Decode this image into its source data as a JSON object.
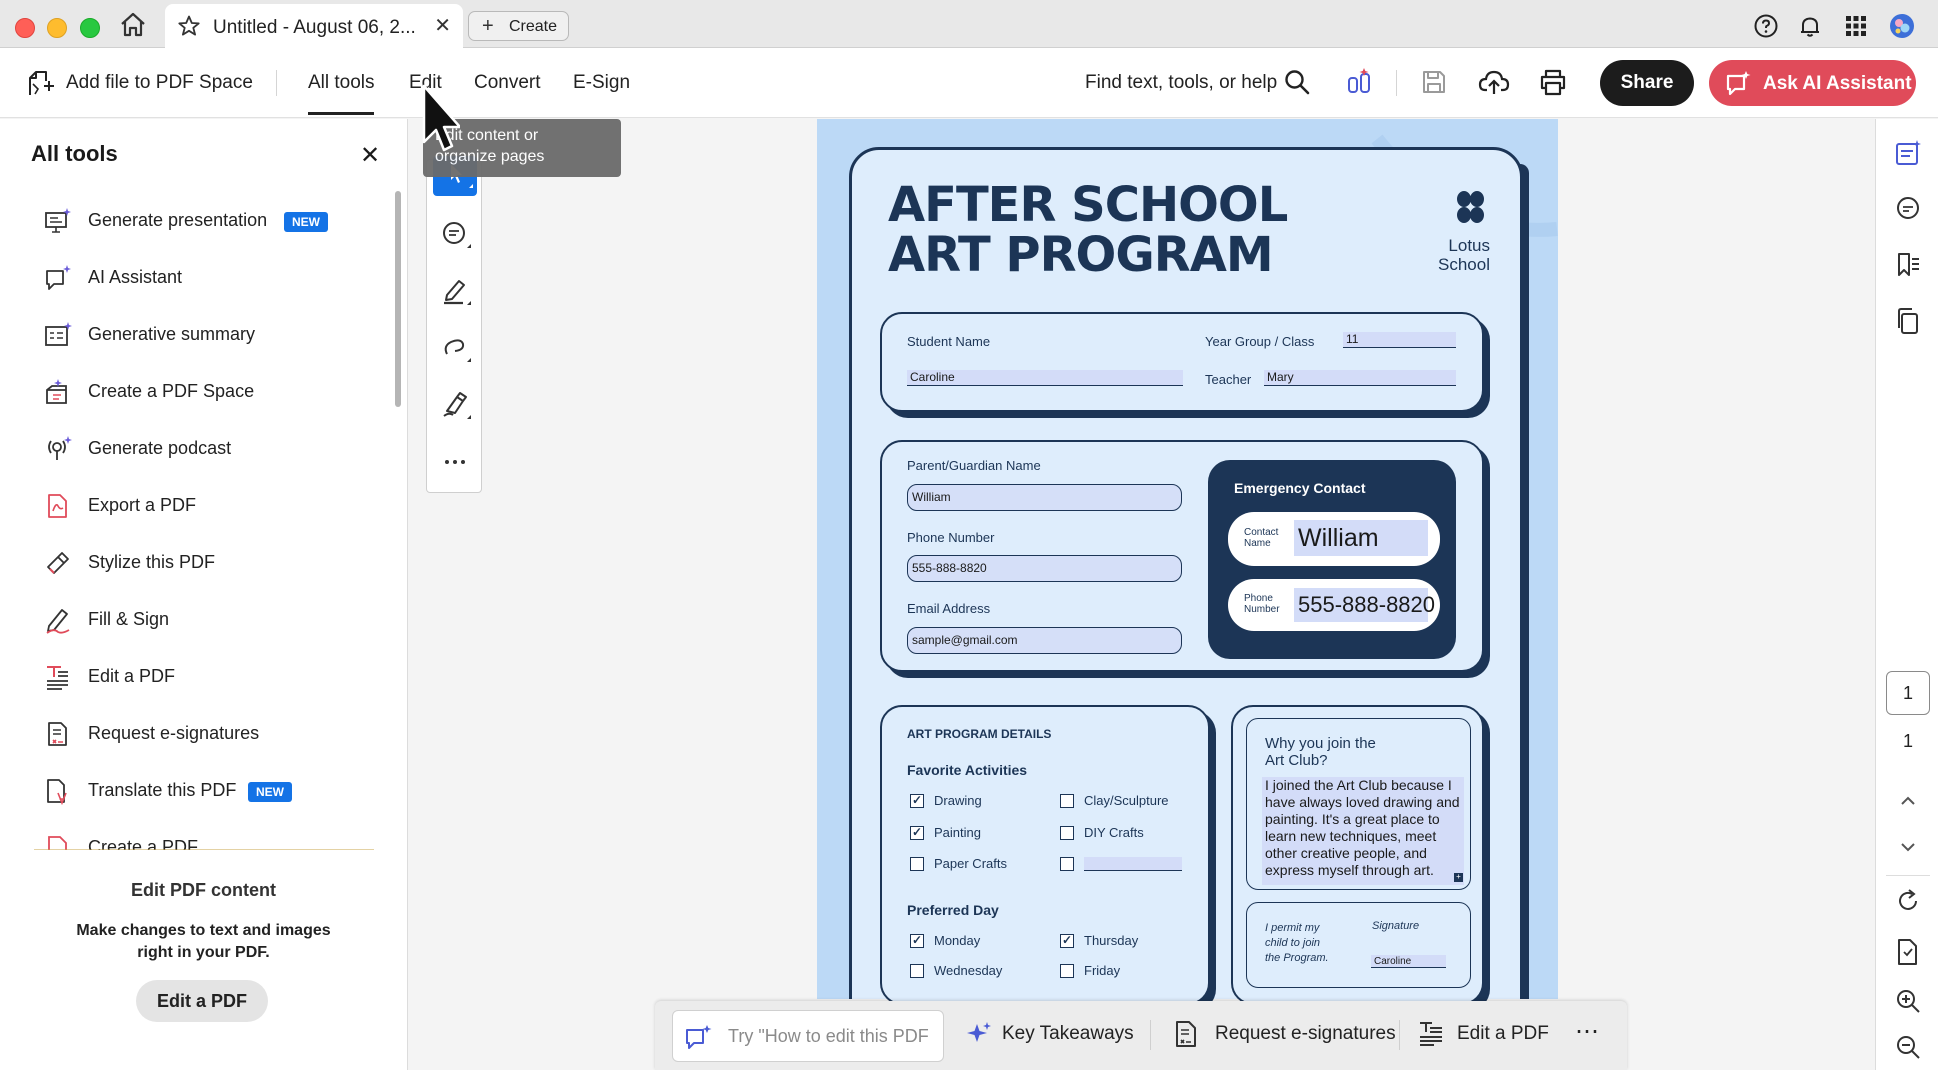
{
  "window": {
    "tab_title": "Untitled - August 06, 2...",
    "create_label": "Create"
  },
  "toolbar": {
    "add_file": "Add file to PDF Space",
    "tabs": [
      "All tools",
      "Edit",
      "Convert",
      "E-Sign"
    ],
    "find_text": "Find text, tools, or help",
    "share": "Share",
    "ask_ai": "Ask AI Assistant"
  },
  "tooltip": {
    "line1": "Edit content or",
    "line2": "organize pages"
  },
  "left_panel": {
    "title": "All tools",
    "tools": [
      {
        "label": "Generate presentation",
        "badge": "NEW",
        "icon": "presentation-ai-icon"
      },
      {
        "label": "AI Assistant",
        "badge": "",
        "icon": "ai-assistant-icon"
      },
      {
        "label": "Generative summary",
        "badge": "",
        "icon": "summary-ai-icon"
      },
      {
        "label": "Create a PDF Space",
        "badge": "",
        "icon": "pdf-space-icon"
      },
      {
        "label": "Generate podcast",
        "badge": "",
        "icon": "podcast-icon"
      },
      {
        "label": "Export a PDF",
        "badge": "",
        "icon": "export-pdf-icon"
      },
      {
        "label": "Stylize this PDF",
        "badge": "",
        "icon": "stylize-icon"
      },
      {
        "label": "Fill & Sign",
        "badge": "",
        "icon": "fill-sign-icon"
      },
      {
        "label": "Edit a PDF",
        "badge": "",
        "icon": "edit-pdf-icon"
      },
      {
        "label": "Request e-signatures",
        "badge": "",
        "icon": "request-signature-icon"
      },
      {
        "label": "Translate this PDF",
        "badge": "NEW",
        "icon": "translate-icon"
      },
      {
        "label": "Create a PDF",
        "badge": "",
        "icon": "create-pdf-icon"
      }
    ],
    "footer_title": "Edit PDF content",
    "footer_desc": "Make changes to text and images right in your PDF.",
    "footer_button": "Edit a PDF"
  },
  "document": {
    "title_line1": "AFTER SCHOOL",
    "title_line2": "ART PROGRAM",
    "school_line1": "Lotus",
    "school_line2": "School",
    "student_name_label": "Student Name",
    "student_name_value": "Caroline",
    "year_group_label": "Year Group / Class",
    "year_group_value": "11",
    "teacher_label": "Teacher",
    "teacher_value": "Mary",
    "parent_label": "Parent/Guardian Name",
    "parent_value": "William",
    "phone_label": "Phone Number",
    "phone_value": "555-888-8820",
    "email_label": "Email Address",
    "email_value": "sample@gmail.com",
    "emergency_title": "Emergency Contact",
    "contact_name_label_1": "Contact",
    "contact_name_label_2": "Name",
    "contact_name_value": "William",
    "contact_phone_label_1": "Phone",
    "contact_phone_label_2": "Number",
    "contact_phone_value": "555-888-8820",
    "details_title": "ART PROGRAM DETAILS",
    "activities_title": "Favorite Activities",
    "activities": [
      {
        "label": "Drawing",
        "checked": true
      },
      {
        "label": "Clay/Sculpture",
        "checked": false
      },
      {
        "label": "Painting",
        "checked": true
      },
      {
        "label": "DIY Crafts",
        "checked": false
      },
      {
        "label": "Paper Crafts",
        "checked": false
      },
      {
        "label": "",
        "checked": false
      }
    ],
    "day_title": "Preferred Day",
    "days": [
      {
        "label": "Monday",
        "checked": true
      },
      {
        "label": "Thursday",
        "checked": true
      },
      {
        "label": "Wednesday",
        "checked": false
      },
      {
        "label": "Friday",
        "checked": false
      }
    ],
    "why_title_1": "Why you join the",
    "why_title_2": "Art Club?",
    "why_text": "I joined the Art Club because I have always loved drawing and painting. It's a great place to learn new techniques, meet other creative people, and express myself through art.",
    "permit_1": "I permit my",
    "permit_2": "child to join",
    "permit_3": "the Program.",
    "signature_label": "Signature",
    "signature_value": "Caroline"
  },
  "bottom_bar": {
    "input_placeholder": "Try \"How to edit this PDF",
    "key_takeaways": "Key Takeaways",
    "request_signatures": "Request e-signatures",
    "edit_pdf": "Edit a PDF",
    "more": "⋯"
  },
  "right_rail": {
    "current_page": "1",
    "total_pages": "1"
  },
  "colors": {
    "accent_blue": "#1473e6",
    "ai_button": "#e04b5a",
    "doc_navy": "#1c3556",
    "doc_bg": "#bcd9f6"
  }
}
